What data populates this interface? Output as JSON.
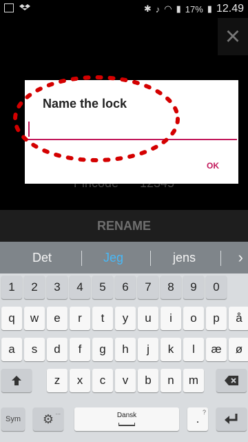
{
  "status": {
    "battery_percent": "17%",
    "time": "12.49"
  },
  "background": {
    "pincode_label": "Pincode",
    "pincode_value": "12345",
    "rename_label": "RENAME"
  },
  "dialog": {
    "title": "Name the lock",
    "input_value": "",
    "ok_label": "OK"
  },
  "suggestions": [
    "Det",
    "Jeg",
    "jens"
  ],
  "keyboard": {
    "number_row": [
      "1",
      "2",
      "3",
      "4",
      "5",
      "6",
      "7",
      "8",
      "9",
      "0"
    ],
    "row1": [
      "q",
      "w",
      "e",
      "r",
      "t",
      "y",
      "u",
      "i",
      "o",
      "p",
      "å"
    ],
    "row2": [
      "a",
      "s",
      "d",
      "f",
      "g",
      "h",
      "j",
      "k",
      "l",
      "æ",
      "ø"
    ],
    "row3": [
      "z",
      "x",
      "c",
      "v",
      "b",
      "n",
      "m"
    ],
    "sym_label": "Sym",
    "space_label": "Dansk",
    "period": ".",
    "period_hint": "?",
    "settings_hint": "..."
  },
  "colors": {
    "accent": "#c2185b",
    "suggestion_highlight": "#49b8f6",
    "annotation_dots": "#d40000"
  }
}
